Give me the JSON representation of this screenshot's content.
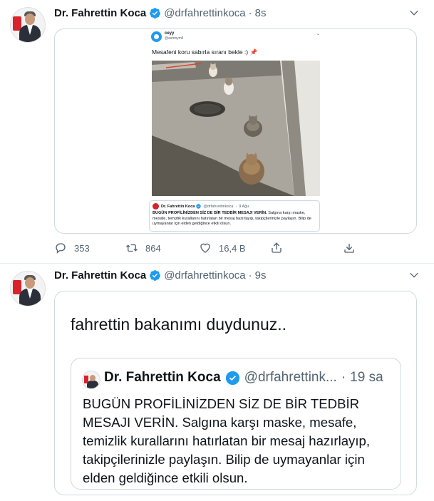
{
  "tweets": [
    {
      "author": {
        "name": "Dr. Fahrettin Koca",
        "handle": "@drfahrettinkoca",
        "time": "8s"
      },
      "media": {
        "screenshot_author": "ceyy",
        "screenshot_handle": "@asmnymll",
        "screenshot_text": "Mesafeni koru sabırla sıranı bekle :)",
        "quoted": {
          "name": "Dr. Fahrettin Koca",
          "handle": "@drfahrettinkoca",
          "time": "9 Ağu",
          "text_bold": "BUGÜN PROFİLİNİZDEN SİZ DE BİR TEDBİR MESAJI VERİN.",
          "text_rest": " Salgına karşı maske, mesafe, temizlik kurallarını hatırlatan bir mesaj hazırlayıp, takipçilerinizle paylaşın. Bilip de uymayanlar için elden geldiğince etkili olsun."
        }
      },
      "actions": {
        "replies": "353",
        "retweets": "864",
        "likes": "16,4 B"
      }
    },
    {
      "author": {
        "name": "Dr. Fahrettin Koca",
        "handle": "@drfahrettinkoca",
        "time": "9s"
      },
      "media": {
        "text": "fahrettin bakanımı duydunuz..",
        "quoted": {
          "name": "Dr. Fahrettin Koca",
          "handle": "@drfahrettink...",
          "time": "19 sa",
          "text": "BUGÜN PROFİLİNİZDEN SİZ DE BİR TEDBİR MESAJI VERİN. Salgına karşı maske, mesafe, temizlik kurallarını hatırlatan bir mesaj hazırlayıp, takipçilerinizle paylaşın. Bilip de uymayanlar için elden geldiğince etkili olsun."
        }
      }
    }
  ],
  "separator": "·",
  "colors": {
    "verified": "#1d9bf0",
    "secondary_text": "#536471",
    "border": "#cfd9de"
  },
  "icons": [
    "chevron-down-icon",
    "verified-badge-icon",
    "reply-icon",
    "retweet-icon",
    "like-icon",
    "share-icon",
    "upload-icon"
  ]
}
